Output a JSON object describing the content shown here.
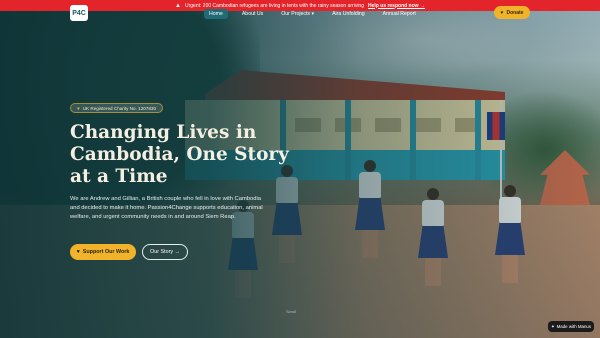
{
  "announcement": {
    "icon": "warning-icon",
    "text": "Urgent: 200 Cambodian refugees are living in tents with the rainy season arriving",
    "link": "Help us respond now →"
  },
  "header": {
    "logo_text": "P4C",
    "nav": [
      {
        "label": "Home",
        "active": true
      },
      {
        "label": "About Us"
      },
      {
        "label": "Our Projects ▾"
      },
      {
        "label": "Aira Unfolding"
      },
      {
        "label": "Annual Report"
      }
    ],
    "donate_label": "Donate"
  },
  "hero": {
    "badge": "UK Registered Charity No. 1207830",
    "title": "Changing Lives in Cambodia, One Story at a Time",
    "description": "We are Andrew and Gillian, a British couple who fell in love with Cambodia and decided to make it home. Passion4Change supports education, animal welfare, and urgent community needs in and around Siem Reap.",
    "primary_button": "Support Our Work",
    "secondary_button": "Our Story →",
    "scroll_hint": "Scroll"
  },
  "footer_badge": {
    "text": "Made with Manus"
  },
  "colors": {
    "accent": "#f0b32a",
    "alert": "#e3242b",
    "teal": "#1f6b76"
  }
}
